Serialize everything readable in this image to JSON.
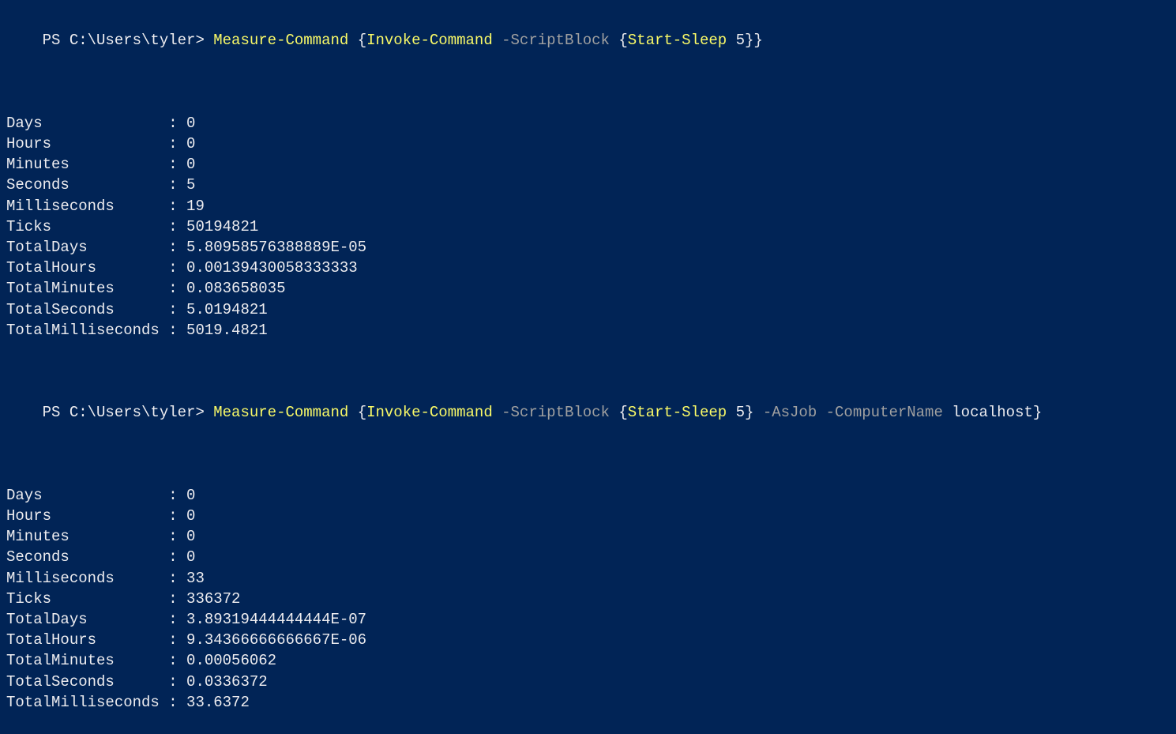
{
  "prompt1": {
    "prefix": "PS C:\\Users\\tyler> ",
    "parts": [
      {
        "text": "Measure-Command ",
        "cls": "cmd-yellow"
      },
      {
        "text": "{",
        "cls": "cmd-white"
      },
      {
        "text": "Invoke-Command ",
        "cls": "cmd-yellow"
      },
      {
        "text": "-ScriptBlock ",
        "cls": "cmd-gray"
      },
      {
        "text": "{",
        "cls": "cmd-white"
      },
      {
        "text": "Start-Sleep ",
        "cls": "cmd-yellow"
      },
      {
        "text": "5",
        "cls": "cmd-white"
      },
      {
        "text": "}}",
        "cls": "cmd-white"
      }
    ]
  },
  "output1": [
    {
      "label": "Days",
      "value": "0"
    },
    {
      "label": "Hours",
      "value": "0"
    },
    {
      "label": "Minutes",
      "value": "0"
    },
    {
      "label": "Seconds",
      "value": "5"
    },
    {
      "label": "Milliseconds",
      "value": "19"
    },
    {
      "label": "Ticks",
      "value": "50194821"
    },
    {
      "label": "TotalDays",
      "value": "5.80958576388889E-05"
    },
    {
      "label": "TotalHours",
      "value": "0.00139430058333333"
    },
    {
      "label": "TotalMinutes",
      "value": "0.083658035"
    },
    {
      "label": "TotalSeconds",
      "value": "5.0194821"
    },
    {
      "label": "TotalMilliseconds",
      "value": "5019.4821"
    }
  ],
  "prompt2": {
    "prefix": "PS C:\\Users\\tyler> ",
    "parts": [
      {
        "text": "Measure-Command ",
        "cls": "cmd-yellow"
      },
      {
        "text": "{",
        "cls": "cmd-white"
      },
      {
        "text": "Invoke-Command ",
        "cls": "cmd-yellow"
      },
      {
        "text": "-ScriptBlock ",
        "cls": "cmd-gray"
      },
      {
        "text": "{",
        "cls": "cmd-white"
      },
      {
        "text": "Start-Sleep ",
        "cls": "cmd-yellow"
      },
      {
        "text": "5",
        "cls": "cmd-white"
      },
      {
        "text": "} ",
        "cls": "cmd-white"
      },
      {
        "text": "-AsJob -ComputerName ",
        "cls": "cmd-gray"
      },
      {
        "text": "localhost",
        "cls": "cmd-white"
      },
      {
        "text": "}",
        "cls": "cmd-white"
      }
    ]
  },
  "output2": [
    {
      "label": "Days",
      "value": "0"
    },
    {
      "label": "Hours",
      "value": "0"
    },
    {
      "label": "Minutes",
      "value": "0"
    },
    {
      "label": "Seconds",
      "value": "0"
    },
    {
      "label": "Milliseconds",
      "value": "33"
    },
    {
      "label": "Ticks",
      "value": "336372"
    },
    {
      "label": "TotalDays",
      "value": "3.89319444444444E-07"
    },
    {
      "label": "TotalHours",
      "value": "9.34366666666667E-06"
    },
    {
      "label": "TotalMinutes",
      "value": "0.00056062"
    },
    {
      "label": "TotalSeconds",
      "value": "0.0336372"
    },
    {
      "label": "TotalMilliseconds",
      "value": "33.6372"
    }
  ],
  "labelWidth": 18
}
